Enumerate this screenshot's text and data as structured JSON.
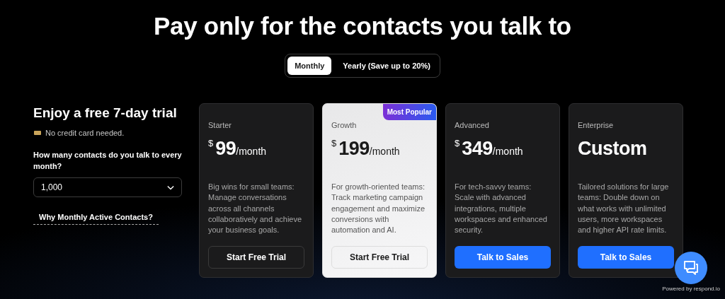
{
  "heading": "Pay only for the contacts you talk to",
  "billing_tabs": [
    {
      "label": "Monthly",
      "selected": true
    },
    {
      "label": "Yearly (Save up to 20%)",
      "selected": false
    }
  ],
  "trial": {
    "title": "Enjoy a free 7-day trial",
    "note": "No credit card needed.",
    "question": "How many contacts do you talk to every month?",
    "contacts_select": {
      "value": "1,000"
    },
    "link": "Why Monthly Active Contacts?"
  },
  "plans": [
    {
      "kind": "dark",
      "name": "Starter",
      "currency": "$",
      "amount": "99",
      "period": "/month",
      "description": "Big wins for small teams: Manage conversations across all channels collaboratively and achieve your business goals.",
      "button": {
        "label": "Start Free Trial",
        "kind": "outline"
      }
    },
    {
      "kind": "light",
      "badge": "Most Popular",
      "name": "Growth",
      "currency": "$",
      "amount": "199",
      "period": "/month",
      "description": "For growth-oriented teams: Track marketing campaign engagement and maximize conversions with automation and AI.",
      "button": {
        "label": "Start Free Trial",
        "kind": "outline"
      }
    },
    {
      "kind": "dark",
      "name": "Advanced",
      "currency": "$",
      "amount": "349",
      "period": "/month",
      "description": "For tech-savvy teams: Scale with advanced integrations, multiple workspaces and enhanced security.",
      "button": {
        "label": "Talk to Sales",
        "kind": "primary"
      }
    },
    {
      "kind": "dark",
      "name": "Enterprise",
      "amount": "Custom",
      "description": "Tailored solutions for large teams: Double down on what works with unlimited users, more workspaces and higher API rate limits.",
      "button": {
        "label": "Talk to Sales",
        "kind": "primary"
      }
    }
  ],
  "powered_by": "Powered by respond.io"
}
